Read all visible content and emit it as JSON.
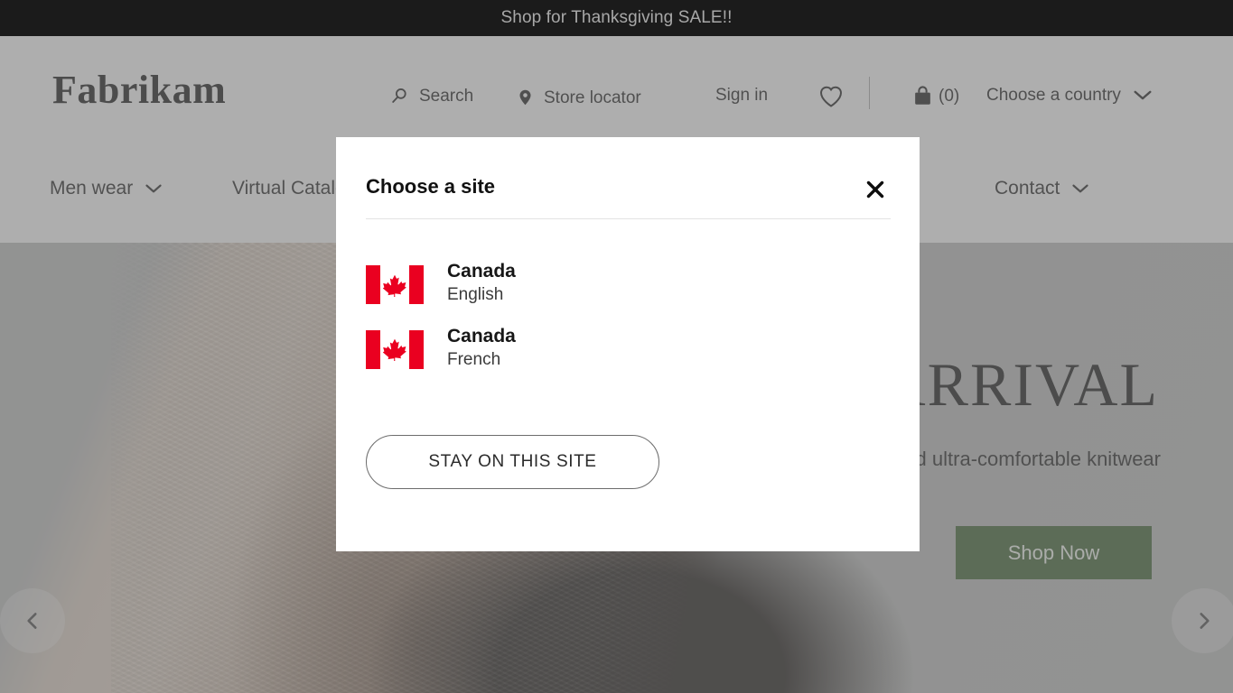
{
  "promo": {
    "text": "Shop for Thanksgiving SALE!!"
  },
  "header": {
    "brand": "Fabrikam",
    "links": [
      {
        "id": "search",
        "label": "Search",
        "icon": "search-icon"
      },
      {
        "id": "store",
        "label": "Store locator",
        "icon": "location-pin-icon"
      },
      {
        "id": "signin",
        "label": "Sign in",
        "icon": "none"
      },
      {
        "id": "wishlist",
        "label": "",
        "icon": "heart-icon"
      },
      {
        "id": "bag",
        "label": "(0)",
        "icon": "shopping-bag-icon"
      },
      {
        "id": "country",
        "label": "Choose a country",
        "icon": "chevron-down-icon"
      }
    ],
    "cart_count": "(0)"
  },
  "nav": {
    "items": [
      {
        "label": "Men wear",
        "has_chevron": true
      },
      {
        "label": "Virtual Catalog",
        "has_chevron": true
      },
      {
        "label": "",
        "has_chevron": false
      },
      {
        "label": "",
        "has_chevron": true
      },
      {
        "label": "Contact",
        "has_chevron": true
      }
    ]
  },
  "hero": {
    "title": "NEW ARRIVAL",
    "subtitle": "Soft and ultra-comfortable knitwear",
    "cta_label": "Shop Now",
    "prev_icon": "chevron-left-icon",
    "next_icon": "chevron-right-icon",
    "cta_color": "#2e5223"
  },
  "modal": {
    "title": "Choose a site",
    "close_icon": "close-icon",
    "options": [
      {
        "flag": "canada-flag-icon",
        "country": "Canada",
        "language": "English"
      },
      {
        "flag": "canada-flag-icon",
        "country": "Canada",
        "language": "French"
      }
    ],
    "stay_button": "STAY ON THIS SITE"
  },
  "colors": {
    "banner_bg": "#1b1b1b",
    "banner_text": "#a8a8a8",
    "flag_red": "#ea0020",
    "cta_green": "#2e5223"
  }
}
